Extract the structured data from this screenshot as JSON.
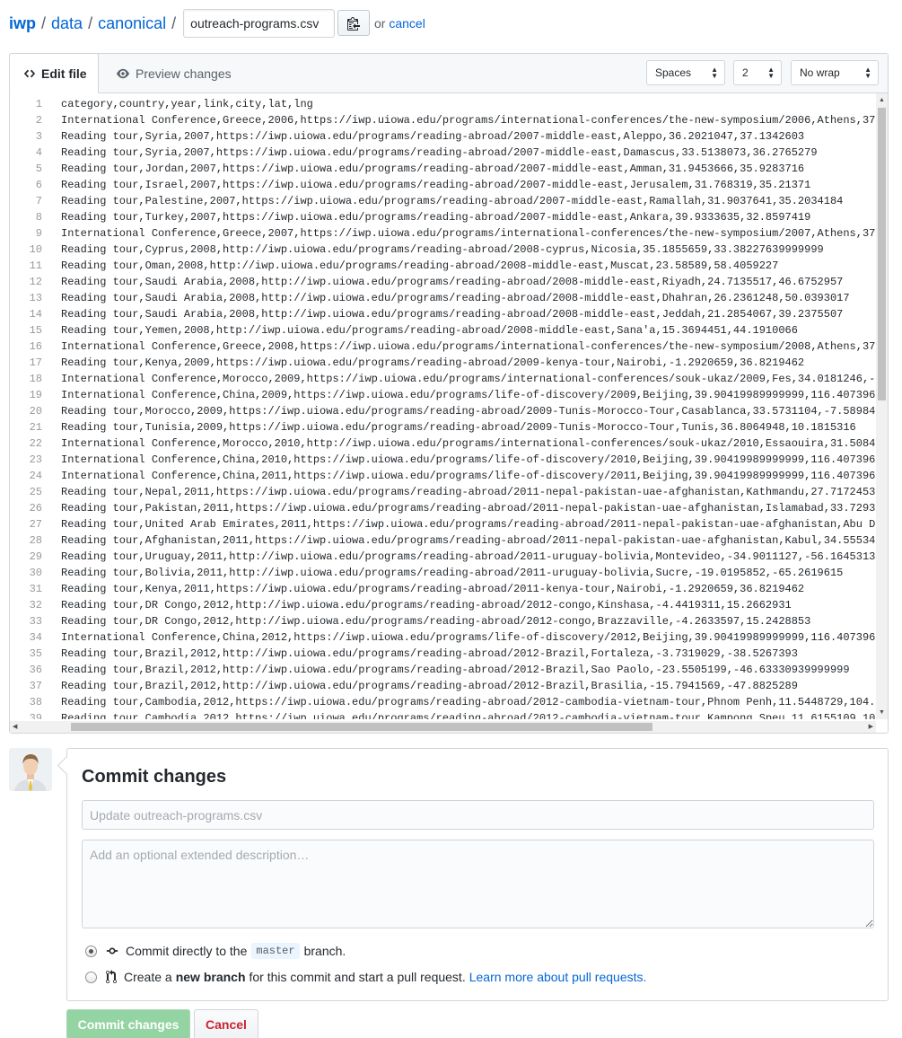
{
  "breadcrumb": {
    "repo": "iwp",
    "sep": "/",
    "segments": [
      "data",
      "canonical"
    ],
    "filename": "outreach-programs.csv",
    "or_text": "or",
    "cancel_link": "cancel"
  },
  "editor": {
    "tab_edit": "Edit file",
    "tab_preview": "Preview changes",
    "indent_mode": "Spaces",
    "indent_size": "2",
    "wrap_mode": "No wrap",
    "lines": [
      "category,country,year,link,city,lat,lng",
      "International Conference,Greece,2006,https://iwp.uiowa.edu/programs/international-conferences/the-new-symposium/2006,Athens,37",
      "Reading tour,Syria,2007,https://iwp.uiowa.edu/programs/reading-abroad/2007-middle-east,Aleppo,36.2021047,37.1342603",
      "Reading tour,Syria,2007,https://iwp.uiowa.edu/programs/reading-abroad/2007-middle-east,Damascus,33.5138073,36.2765279",
      "Reading tour,Jordan,2007,https://iwp.uiowa.edu/programs/reading-abroad/2007-middle-east,Amman,31.9453666,35.9283716",
      "Reading tour,Israel,2007,https://iwp.uiowa.edu/programs/reading-abroad/2007-middle-east,Jerusalem,31.768319,35.21371",
      "Reading tour,Palestine,2007,https://iwp.uiowa.edu/programs/reading-abroad/2007-middle-east,Ramallah,31.9037641,35.2034184",
      "Reading tour,Turkey,2007,https://iwp.uiowa.edu/programs/reading-abroad/2007-middle-east,Ankara,39.9333635,32.8597419",
      "International Conference,Greece,2007,https://iwp.uiowa.edu/programs/international-conferences/the-new-symposium/2007,Athens,37",
      "Reading tour,Cyprus,2008,http://iwp.uiowa.edu/programs/reading-abroad/2008-cyprus,Nicosia,35.1855659,33.38227639999999",
      "Reading tour,Oman,2008,http://iwp.uiowa.edu/programs/reading-abroad/2008-middle-east,Muscat,23.58589,58.4059227",
      "Reading tour,Saudi Arabia,2008,http://iwp.uiowa.edu/programs/reading-abroad/2008-middle-east,Riyadh,24.7135517,46.6752957",
      "Reading tour,Saudi Arabia,2008,http://iwp.uiowa.edu/programs/reading-abroad/2008-middle-east,Dhahran,26.2361248,50.0393017",
      "Reading tour,Saudi Arabia,2008,http://iwp.uiowa.edu/programs/reading-abroad/2008-middle-east,Jeddah,21.2854067,39.2375507",
      "Reading tour,Yemen,2008,http://iwp.uiowa.edu/programs/reading-abroad/2008-middle-east,Sana'a,15.3694451,44.1910066",
      "International Conference,Greece,2008,https://iwp.uiowa.edu/programs/international-conferences/the-new-symposium/2008,Athens,37",
      "Reading tour,Kenya,2009,https://iwp.uiowa.edu/programs/reading-abroad/2009-kenya-tour,Nairobi,-1.2920659,36.8219462",
      "International Conference,Morocco,2009,https://iwp.uiowa.edu/programs/international-conferences/souk-ukaz/2009,Fes,34.0181246,-",
      "International Conference,China,2009,https://iwp.uiowa.edu/programs/life-of-discovery/2009,Beijing,39.90419989999999,116.407396",
      "Reading tour,Morocco,2009,https://iwp.uiowa.edu/programs/reading-abroad/2009-Tunis-Morocco-Tour,Casablanca,33.5731104,-7.58984",
      "Reading tour,Tunisia,2009,https://iwp.uiowa.edu/programs/reading-abroad/2009-Tunis-Morocco-Tour,Tunis,36.8064948,10.1815316",
      "International Conference,Morocco,2010,http://iwp.uiowa.edu/programs/international-conferences/souk-ukaz/2010,Essaouira,31.5084",
      "International Conference,China,2010,https://iwp.uiowa.edu/programs/life-of-discovery/2010,Beijing,39.90419989999999,116.407396",
      "International Conference,China,2011,https://iwp.uiowa.edu/programs/life-of-discovery/2011,Beijing,39.90419989999999,116.407396",
      "Reading tour,Nepal,2011,https://iwp.uiowa.edu/programs/reading-abroad/2011-nepal-pakistan-uae-afghanistan,Kathmandu,27.7172453",
      "Reading tour,Pakistan,2011,https://iwp.uiowa.edu/programs/reading-abroad/2011-nepal-pakistan-uae-afghanistan,Islamabad,33.7293",
      "Reading tour,United Arab Emirates,2011,https://iwp.uiowa.edu/programs/reading-abroad/2011-nepal-pakistan-uae-afghanistan,Abu D",
      "Reading tour,Afghanistan,2011,https://iwp.uiowa.edu/programs/reading-abroad/2011-nepal-pakistan-uae-afghanistan,Kabul,34.55534",
      "Reading tour,Uruguay,2011,http://iwp.uiowa.edu/programs/reading-abroad/2011-uruguay-bolivia,Montevideo,-34.9011127,-56.1645313",
      "Reading tour,Bolivia,2011,http://iwp.uiowa.edu/programs/reading-abroad/2011-uruguay-bolivia,Sucre,-19.0195852,-65.2619615",
      "Reading tour,Kenya,2011,https://iwp.uiowa.edu/programs/reading-abroad/2011-kenya-tour,Nairobi,-1.2920659,36.8219462",
      "Reading tour,DR Congo,2012,http://iwp.uiowa.edu/programs/reading-abroad/2012-congo,Kinshasa,-4.4419311,15.2662931",
      "Reading tour,DR Congo,2012,http://iwp.uiowa.edu/programs/reading-abroad/2012-congo,Brazzaville,-4.2633597,15.2428853",
      "International Conference,China,2012,https://iwp.uiowa.edu/programs/life-of-discovery/2012,Beijing,39.90419989999999,116.407396",
      "Reading tour,Brazil,2012,http://iwp.uiowa.edu/programs/reading-abroad/2012-Brazil,Fortaleza,-3.7319029,-38.5267393",
      "Reading tour,Brazil,2012,http://iwp.uiowa.edu/programs/reading-abroad/2012-Brazil,Sao Paolo,-23.5505199,-46.63330939999999",
      "Reading tour,Brazil,2012,http://iwp.uiowa.edu/programs/reading-abroad/2012-Brazil,Brasilia,-15.7941569,-47.8825289",
      "Reading tour,Cambodia,2012,https://iwp.uiowa.edu/programs/reading-abroad/2012-cambodia-vietnam-tour,Phnom Penh,11.5448729,104.",
      "Reading tour,Cambodia,2012,https://iwp.uiowa.edu/programs/reading-abroad/2012-cambodia-vietnam-tour,Kampong Speu,11.6155109,10",
      ""
    ]
  },
  "commit": {
    "title": "Commit changes",
    "summary_placeholder": "Update outreach-programs.csv",
    "description_placeholder": "Add an optional extended description…",
    "option_direct_prefix": "Commit directly to the",
    "branch_name": "master",
    "option_direct_suffix": "branch.",
    "option_new_prefix": "Create a",
    "option_new_bold": "new branch",
    "option_new_suffix": "for this commit and start a pull request.",
    "learn_more": "Learn more about pull requests.",
    "submit_label": "Commit changes",
    "cancel_label": "Cancel"
  },
  "colors": {
    "link": "#0366d6",
    "commit_button_disabled": "#94d3a2",
    "cancel_text": "#cb2431"
  }
}
